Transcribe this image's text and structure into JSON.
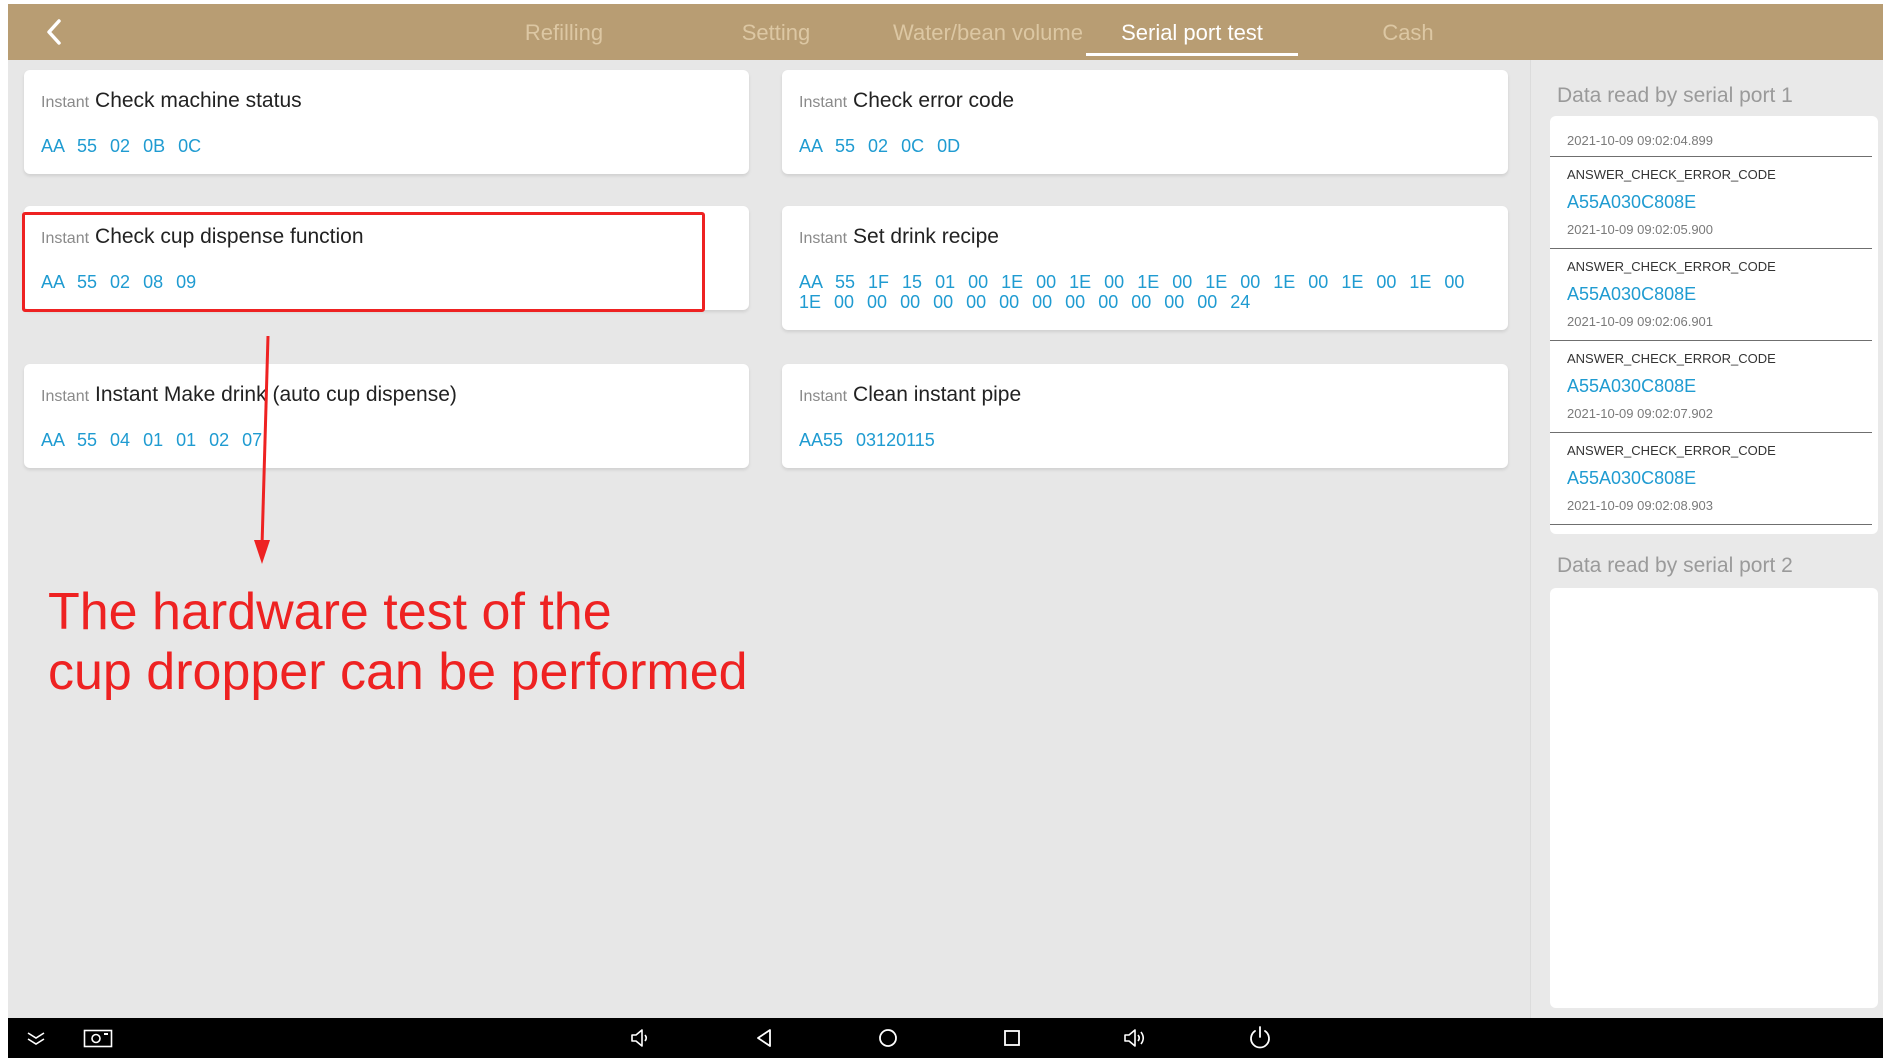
{
  "tabs": [
    {
      "label": "Refilling"
    },
    {
      "label": "Setting"
    },
    {
      "label": "Water/bean volume"
    },
    {
      "label": "Serial port test"
    },
    {
      "label": "Cash"
    }
  ],
  "active_tab": "Serial port test",
  "cards": [
    {
      "tag": "Instant",
      "title": "Check machine status",
      "code": "AA 55 02 0B 0C"
    },
    {
      "tag": "Instant",
      "title": "Check error code",
      "code": "AA 55 02 0C 0D"
    },
    {
      "tag": "Instant",
      "title": "Check cup dispense function",
      "code": "AA 55 02 08 09"
    },
    {
      "tag": "Instant",
      "title": "Set drink recipe",
      "code": "AA 55 1F 15 01 00 1E 00 1E 00 1E 00 1E 00 1E 00 1E 00 1E 00 1E 00 00 00 00 00 00 00 00 00 00 00 00 24"
    },
    {
      "tag": "Instant",
      "title": "Instant  Make drink (auto cup dispense)",
      "code": "AA 55 04 01 01 02 07"
    },
    {
      "tag": "Instant",
      "title": "Clean instant pipe",
      "code": "AA55 03120115"
    }
  ],
  "annotation": {
    "line1": "The hardware test of the",
    "line2": "cup dropper can be performed",
    "color": "#ee2222"
  },
  "serial_port_1": {
    "title": "Data read by serial port 1",
    "first_timestamp": "2021-10-09 09:02:04.899",
    "entries": [
      {
        "label": "ANSWER_CHECK_ERROR_CODE",
        "value": "A55A030C808E",
        "timestamp": "2021-10-09 09:02:05.900"
      },
      {
        "label": "ANSWER_CHECK_ERROR_CODE",
        "value": "A55A030C808E",
        "timestamp": "2021-10-09 09:02:06.901"
      },
      {
        "label": "ANSWER_CHECK_ERROR_CODE",
        "value": "A55A030C808E",
        "timestamp": "2021-10-09 09:02:07.902"
      },
      {
        "label": "ANSWER_CHECK_ERROR_CODE",
        "value": "A55A030C808E",
        "timestamp": "2021-10-09 09:02:08.903"
      }
    ]
  },
  "serial_port_2": {
    "title": "Data read by serial port 2"
  },
  "navbar_icons": [
    "expand-icon",
    "screenshot-icon",
    "volume-down-icon",
    "back-icon",
    "home-icon",
    "recents-icon",
    "volume-up-icon",
    "power-icon"
  ],
  "colors": {
    "header": "#b89d73",
    "tab_inactive": "#dcc7a3",
    "code": "#1f9bd1",
    "background": "#e7e7e7"
  }
}
